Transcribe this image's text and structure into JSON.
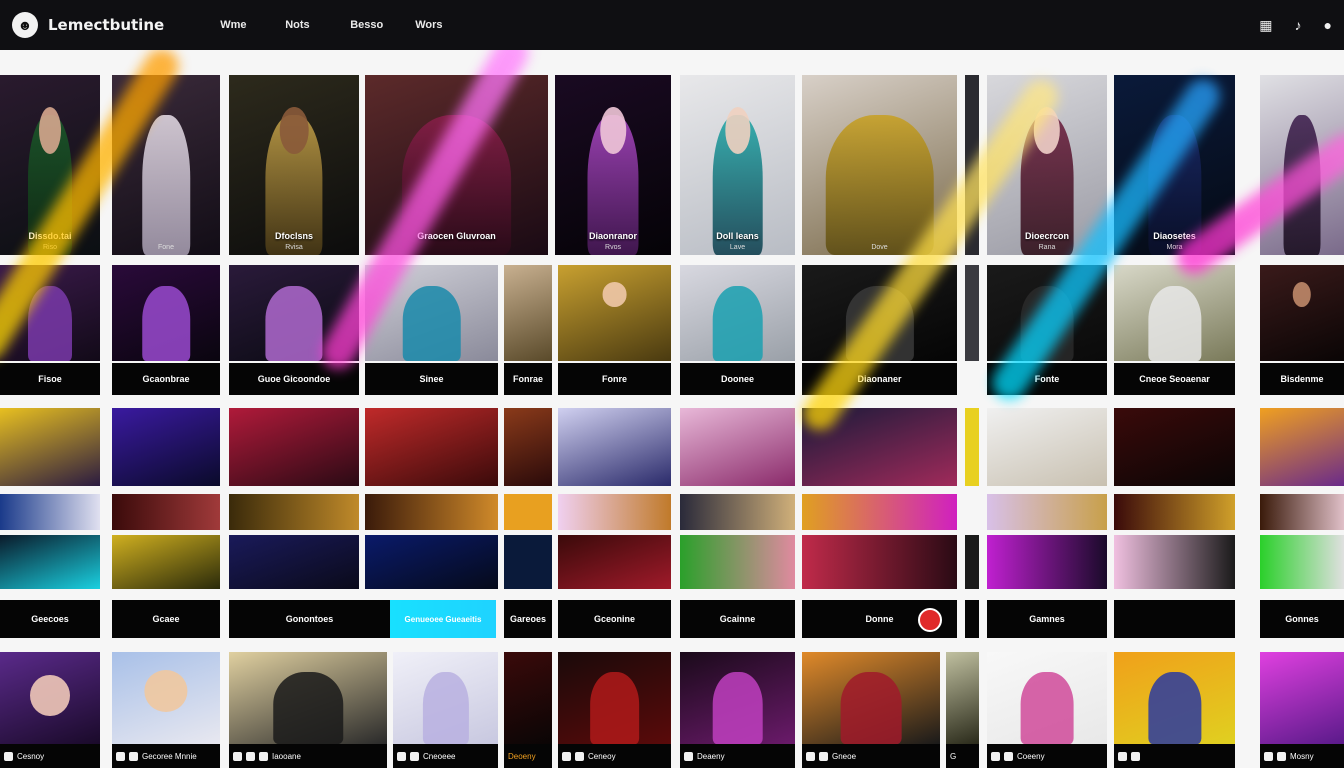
{
  "app": {
    "title": "Lemectbutine"
  },
  "nav": [
    "Wme",
    "Nots",
    "Besso",
    "Wors"
  ],
  "top_icons": [
    "grid-icon",
    "bell-icon",
    "user-icon"
  ],
  "row1": [
    {
      "caption": "Dissdo.tai",
      "sub": "Riso"
    },
    {
      "caption": "",
      "sub": "Fone"
    },
    {
      "caption": "Dfoclsns",
      "sub": "Rvisa"
    },
    {
      "caption": "Graocen Gluvroan",
      "sub": ""
    },
    {
      "caption": "Diaonranor",
      "sub": "Rvos"
    },
    {
      "caption": "Doll leans",
      "sub": "Lave"
    },
    {
      "caption": "",
      "sub": "Dove"
    },
    {
      "caption": "Dioecrcon",
      "sub": "Rana"
    },
    {
      "caption": "Diaosetes",
      "sub": "Mora"
    },
    {
      "caption": "",
      "sub": ""
    }
  ],
  "row2": [
    {
      "label": "Fisoe"
    },
    {
      "label": "Gcaonbrae"
    },
    {
      "label": "Guoe Gicoondoe"
    },
    {
      "label": "Sinee"
    },
    {
      "label": "Fonrae"
    },
    {
      "label": "Fonre"
    },
    {
      "label": "Doonee"
    },
    {
      "label": "Diaonaner"
    },
    {
      "label": "Fonte"
    },
    {
      "label": "Cneoe Seoaenar"
    },
    {
      "label": "Bisdenme"
    }
  ],
  "row4": [
    {
      "label": "Geecoes"
    },
    {
      "label": "Gcaee"
    },
    {
      "label": "Gonontoes"
    },
    {
      "label": "Gareoes"
    },
    {
      "label": "Gceonine"
    },
    {
      "label": "Gcainne"
    },
    {
      "label": "Donne"
    },
    {
      "label": "Gamnes"
    },
    {
      "label": "Gonnes"
    }
  ],
  "row5": [
    {
      "label": "Cesnoy"
    },
    {
      "label": "Gecoree Mnnie"
    },
    {
      "label": "Iaooane"
    },
    {
      "label": "Cneoeee"
    },
    {
      "label": "Deoeny"
    },
    {
      "label": "Ceneoy"
    },
    {
      "label": "Deaeny"
    },
    {
      "label": "Gneoe"
    },
    {
      "label": "Coeeny"
    },
    {
      "label": "Mosny"
    }
  ],
  "banner": {
    "text": "Genueoee Gueaeitis"
  },
  "colors": {
    "accent_pink": "#ff2fd6",
    "accent_yellow": "#ffd400",
    "accent_cyan": "#18e0ff"
  }
}
